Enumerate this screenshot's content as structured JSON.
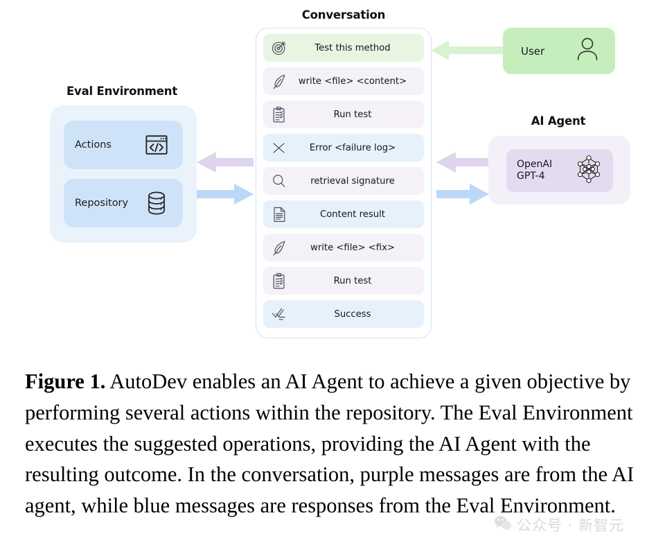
{
  "eval_environment": {
    "title": "Eval Environment",
    "cards": [
      {
        "label": "Actions",
        "icon": "code-window-icon"
      },
      {
        "label": "Repository",
        "icon": "database-icon"
      }
    ]
  },
  "conversation": {
    "title": "Conversation",
    "messages": [
      {
        "text": "Test this method",
        "tone": "green",
        "icon": "target-icon"
      },
      {
        "text": "write <file> <content>",
        "tone": "purple",
        "icon": "quill-icon"
      },
      {
        "text": "Run test",
        "tone": "purple",
        "icon": "clipboard-check-icon"
      },
      {
        "text": "Error <failure log>",
        "tone": "blue",
        "icon": "cross-icon"
      },
      {
        "text": "retrieval signature",
        "tone": "purple",
        "icon": "magnifier-icon"
      },
      {
        "text": "Content result",
        "tone": "blue",
        "icon": "document-icon"
      },
      {
        "text": "write <file> <fix>",
        "tone": "purple",
        "icon": "quill-icon"
      },
      {
        "text": "Run test",
        "tone": "purple",
        "icon": "clipboard-check-icon"
      },
      {
        "text": "Success",
        "tone": "blue",
        "icon": "checklist-icon"
      }
    ]
  },
  "user": {
    "label": "User",
    "icon": "person-icon"
  },
  "ai_agent": {
    "title": "AI Agent",
    "model_name": "OpenAI\nGPT-4",
    "icon": "neural-network-icon"
  },
  "arrows": {
    "user_to_conversation": "green-arrow-left",
    "agent_to_conversation": "purple-arrow-left",
    "conversation_to_agent": "blue-arrow-right",
    "conversation_to_eval": "purple-arrow-left",
    "eval_to_conversation": "blue-arrow-right"
  },
  "caption": {
    "label": "Figure 1.",
    "body": " AutoDev enables an AI Agent to achieve a given objective by performing several actions within the repository. The Eval Environment executes the suggested operations, providing the AI Agent with the resulting outcome. In the conversation, purple messages are from the AI agent, while blue messages are responses from the Eval Environment."
  },
  "watermark": {
    "text": "公众号 · 新智元",
    "icon": "wechat-icon"
  },
  "colors": {
    "green_message": "#e6f6e3",
    "purple_message": "#f5f1f9",
    "blue_message": "#e6f1fb",
    "eval_box": "#eaf3fc",
    "eval_card": "#cfe3f8",
    "agent_box": "#f4f0fa",
    "agent_card": "#e3dcf0",
    "user_box": "#c5eebc",
    "arrow_purple": "#ded4ec",
    "arrow_blue": "#b9d9f6",
    "arrow_green": "#d7f1cf"
  }
}
